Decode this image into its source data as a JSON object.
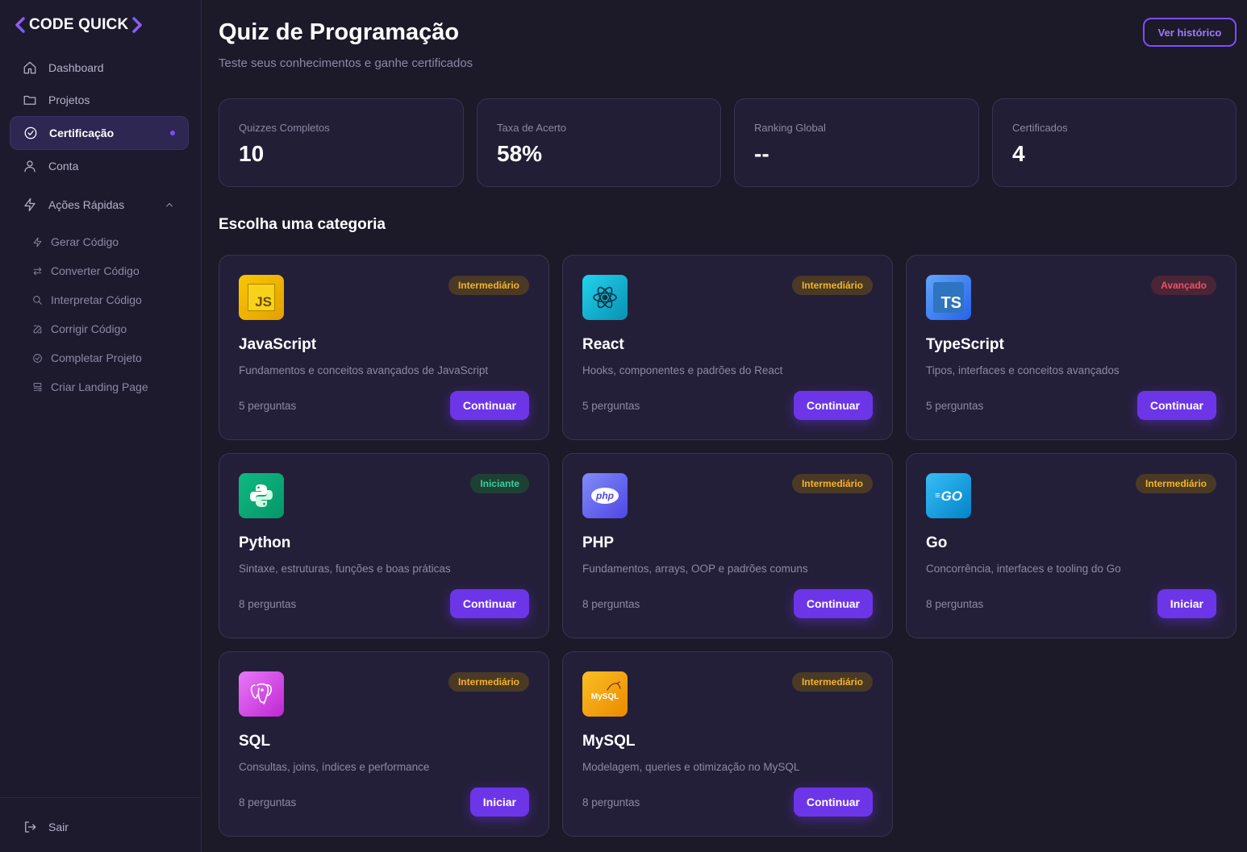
{
  "brand": {
    "name": "CODE QUICK"
  },
  "sidebar": {
    "items": [
      {
        "label": "Dashboard",
        "icon": "home-icon"
      },
      {
        "label": "Projetos",
        "icon": "folder-icon"
      },
      {
        "label": "Certificação",
        "icon": "check-circle-icon",
        "active": true
      },
      {
        "label": "Conta",
        "icon": "user-icon"
      }
    ],
    "quick_actions": {
      "label": "Ações Rápidas",
      "icon": "bolt-icon",
      "items": [
        {
          "label": "Gerar Código",
          "icon": "bolt-icon"
        },
        {
          "label": "Converter Código",
          "icon": "arrows-exchange-icon"
        },
        {
          "label": "Interpretar Código",
          "icon": "search-icon"
        },
        {
          "label": "Corrigir Código",
          "icon": "edit-icon"
        },
        {
          "label": "Completar Projeto",
          "icon": "check-circle-icon"
        },
        {
          "label": "Criar Landing Page",
          "icon": "layout-icon"
        }
      ]
    },
    "logout_label": "Sair"
  },
  "header": {
    "title": "Quiz de Programação",
    "subtitle": "Teste seus conhecimentos e ganhe certificados",
    "history_button": "Ver histórico"
  },
  "stats": [
    {
      "label": "Quizzes Completos",
      "value": "10"
    },
    {
      "label": "Taxa de Acerto",
      "value": "58%"
    },
    {
      "label": "Ranking Global",
      "value": "--"
    },
    {
      "label": "Certificados",
      "value": "4"
    }
  ],
  "section_title": "Escolha uma categoria",
  "quizzes": [
    {
      "title": "JavaScript",
      "description": "Fundamentos e conceitos avançados de JavaScript",
      "level": "Intermediário",
      "questions": "5 perguntas",
      "action": "Continuar",
      "icon": "javascript-logo-icon",
      "icon_text": "JS",
      "icon_color": "#f5b800"
    },
    {
      "title": "React",
      "description": "Hooks, componentes e padrões do React",
      "level": "Intermediário",
      "questions": "5 perguntas",
      "action": "Continuar",
      "icon": "react-logo-icon",
      "icon_color": "#06b6d4"
    },
    {
      "title": "TypeScript",
      "description": "Tipos, interfaces e conceitos avançados",
      "level": "Avançado",
      "questions": "5 perguntas",
      "action": "Continuar",
      "icon": "typescript-logo-icon",
      "icon_text": "TS",
      "icon_color": "#3b82f6"
    },
    {
      "title": "Python",
      "description": "Sintaxe, estruturas, funções e boas práticas",
      "level": "Iniciante",
      "questions": "8 perguntas",
      "action": "Continuar",
      "icon": "python-logo-icon",
      "icon_color": "#10b981"
    },
    {
      "title": "PHP",
      "description": "Fundamentos, arrays, OOP e padrões comuns",
      "level": "Intermediário",
      "questions": "8 perguntas",
      "action": "Continuar",
      "icon": "php-logo-icon",
      "icon_text": "php",
      "icon_color": "#6366f1"
    },
    {
      "title": "Go",
      "description": "Concorrência, interfaces e tooling do Go",
      "level": "Intermediário",
      "questions": "8 perguntas",
      "action": "Iniciar",
      "icon": "go-logo-icon",
      "icon_text": "GO",
      "icon_color": "#0ea5e9"
    },
    {
      "title": "SQL",
      "description": "Consultas, joins, índices e performance",
      "level": "Intermediário",
      "questions": "8 perguntas",
      "action": "Iniciar",
      "icon": "postgresql-logo-icon",
      "icon_color": "#d946ef"
    },
    {
      "title": "MySQL",
      "description": "Modelagem, queries e otimização no MySQL",
      "level": "Intermediário",
      "questions": "8 perguntas",
      "action": "Continuar",
      "icon": "mysql-logo-icon",
      "icon_text": "MySQL",
      "icon_color": "#f59e0b"
    }
  ],
  "colors": {
    "accent": "#6d35e8",
    "background": "#1c1929",
    "card": "#241f39",
    "badge_intermediate": "#f5b324",
    "badge_advanced": "#f0506a",
    "badge_beginner": "#34d399"
  }
}
